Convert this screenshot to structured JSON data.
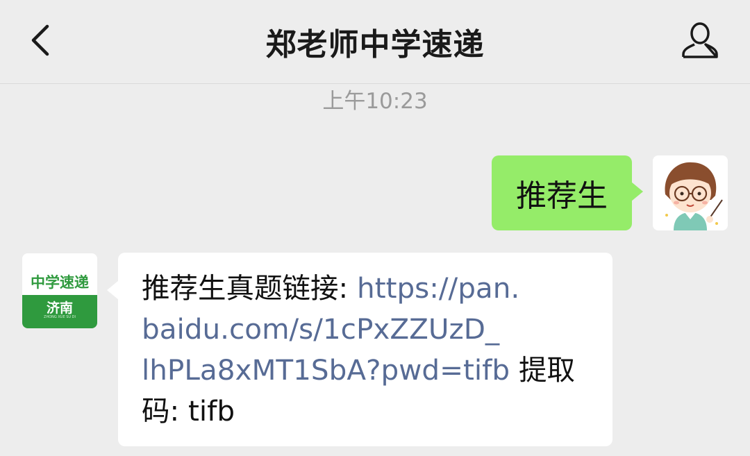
{
  "header": {
    "title": "郑老师中学速递",
    "back_icon": "chevron-left-icon",
    "profile_icon": "person-icon"
  },
  "timestamp": "上午10:23",
  "messages": [
    {
      "from": "me",
      "text": "推荐生"
    },
    {
      "from": "other",
      "prefix": "推荐生真题链接: ",
      "link": "https://pan.baidu.com/s/1cPxZZUzD_lhPLa8xMT1SbA?pwd=tifb",
      "link_line1": "https://pan.",
      "link_line2": "baidu.com/s/1cPxZZUzD_",
      "link_line3": "lhPLa8xMT1SbA?pwd=tifb",
      "mid_text": " 提取",
      "suffix": "码: tifb"
    }
  ],
  "avatars": {
    "me": "cartoon-teacher-avatar",
    "other": {
      "top_text": "中学速递",
      "bottom_text": "济南",
      "sub_text": "ZHONG XUE SU DI"
    }
  },
  "colors": {
    "background": "#ededed",
    "my_bubble": "#95ec69",
    "other_bubble": "#ffffff",
    "link": "#576b95",
    "brand_green": "#2f9a3e"
  }
}
